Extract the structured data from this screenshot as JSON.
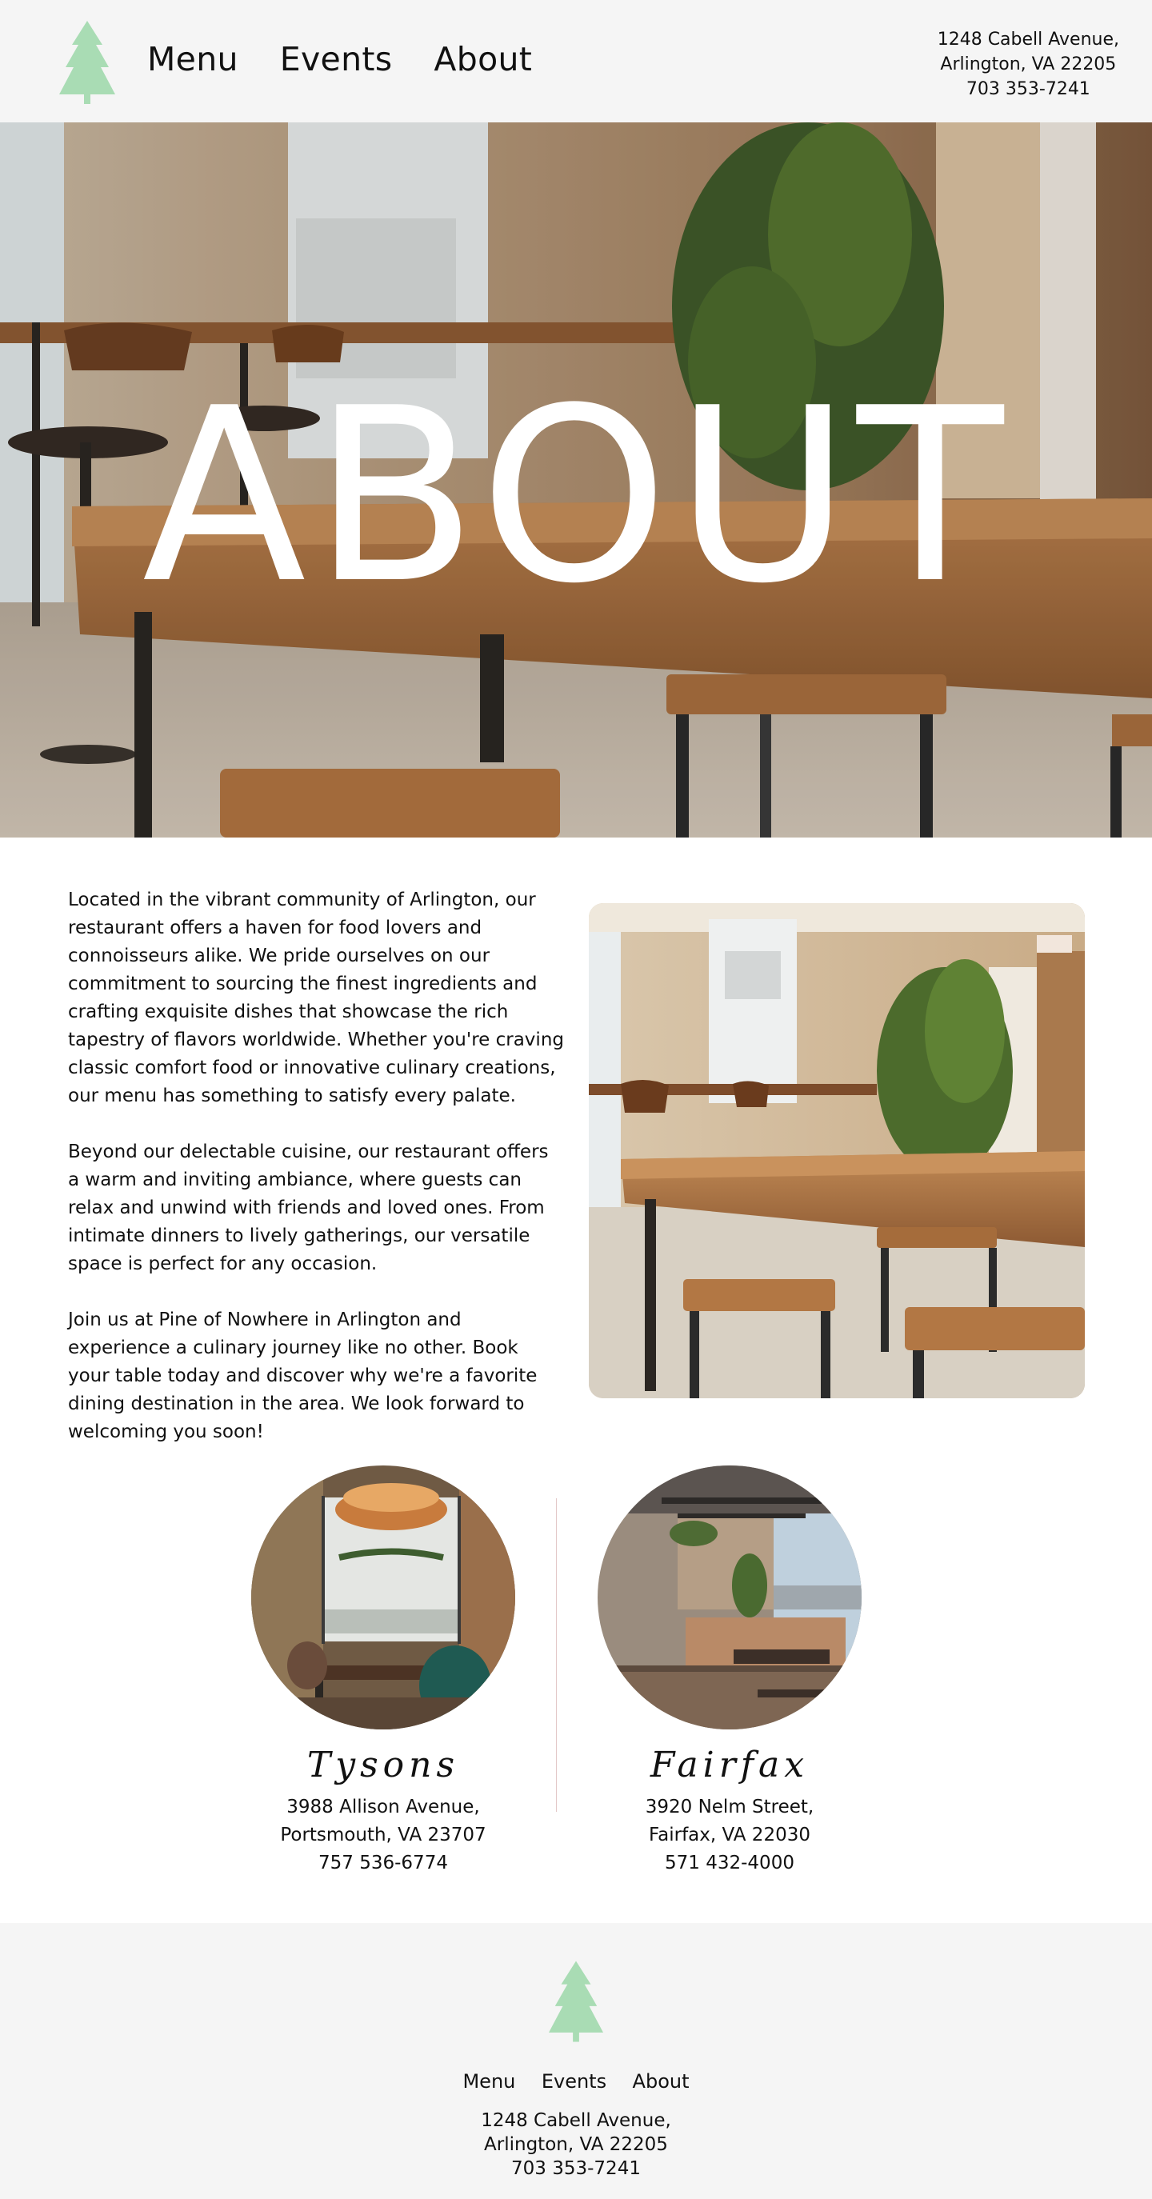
{
  "header": {
    "logo_icon": "pine-tree-icon",
    "nav": [
      "Menu",
      "Events",
      "About"
    ],
    "address_line1": "1248 Cabell Avenue,",
    "address_line2": "Arlington, VA 22205",
    "phone": "703 353-7241"
  },
  "hero": {
    "title": "ABOUT"
  },
  "intro": {
    "paragraphs": [
      "Located in the vibrant community of Arlington, our restaurant offers a haven for food lovers and connoisseurs alike. We pride ourselves on our commitment to sourcing the finest ingredients and crafting exquisite dishes that showcase the rich tapestry of flavors worldwide. Whether you're craving classic comfort food or innovative culinary creations, our menu has something to satisfy every palate.",
      "Beyond our delectable cuisine, our restaurant offers a warm and inviting ambiance, where guests can relax and unwind with friends and loved ones. From intimate dinners to lively gatherings, our versatile space is perfect for any occasion.",
      "Join us at Pine of Nowhere in Arlington and experience a culinary journey like no other. Book your table today and discover why we're a favorite dining destination in the area. We look forward to welcoming you soon!"
    ]
  },
  "locations": [
    {
      "name": "Tysons",
      "address_line1": "3988 Allison Avenue,",
      "address_line2": "Portsmouth, VA 23707",
      "phone": "757 536-6774"
    },
    {
      "name": "Fairfax",
      "address_line1": "3920 Nelm Street,",
      "address_line2": "Fairfax, VA 22030",
      "phone": "571 432-4000"
    }
  ],
  "footer": {
    "logo_icon": "pine-tree-icon",
    "nav": [
      "Menu",
      "Events",
      "About"
    ],
    "address_line1": "1248 Cabell Avenue,",
    "address_line2": "Arlington, VA 22205",
    "phone": "703 353-7241"
  },
  "colors": {
    "header_bg": "#f5f5f5",
    "tree_green": "#a9dcb4",
    "divider": "#e3c8c8",
    "text": "#111111"
  }
}
